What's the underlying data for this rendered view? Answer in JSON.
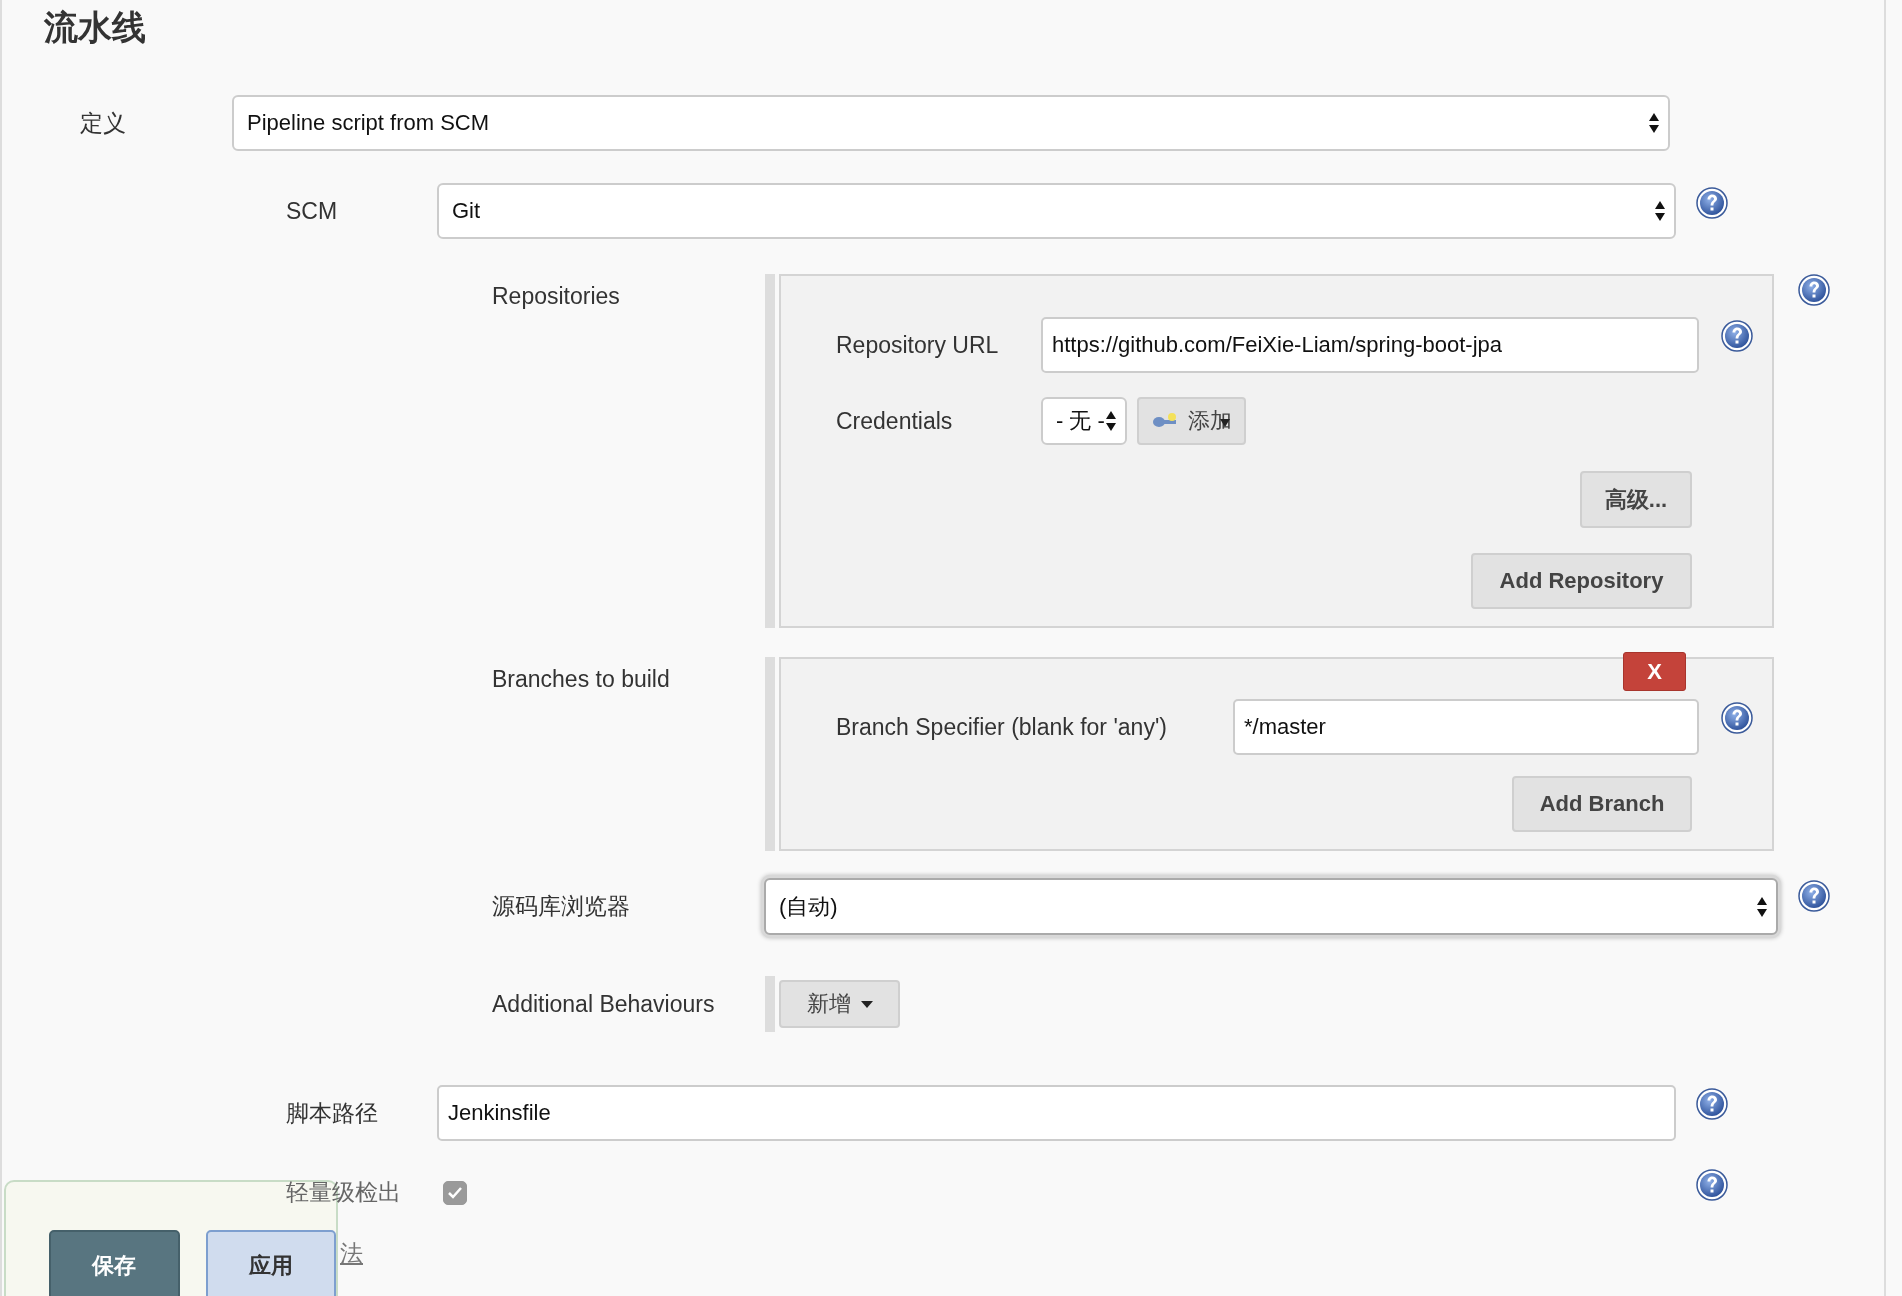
{
  "title": "流水线",
  "definition": {
    "label": "定义",
    "value": "Pipeline script from SCM"
  },
  "scm": {
    "label": "SCM",
    "value": "Git"
  },
  "repositories": {
    "label": "Repositories",
    "url_label": "Repository URL",
    "url": "https://github.com/FeiXie-Liam/spring-boot-jpa",
    "credentials_label": "Credentials",
    "credentials_value": "- 无 -",
    "add_credentials_button": "添加",
    "advanced_button": "高级...",
    "add_repository_button": "Add Repository"
  },
  "branches": {
    "label": "Branches to build",
    "delete_button": "X",
    "specifier_label": "Branch Specifier (blank for 'any')",
    "specifier": "*/master",
    "add_branch_button": "Add Branch"
  },
  "repository_browser": {
    "label": "源码库浏览器",
    "value": "(自动)",
    "focused": true
  },
  "additional_behaviours": {
    "label": "Additional Behaviours",
    "add_button": "新增"
  },
  "script_path": {
    "label": "脚本路径",
    "value": "Jenkinsfile"
  },
  "lightweight_checkout": {
    "label": "轻量级检出",
    "checked": true
  },
  "pipeline_syntax_link": "法",
  "footer": {
    "save_button": "保存",
    "apply_button": "应用"
  }
}
